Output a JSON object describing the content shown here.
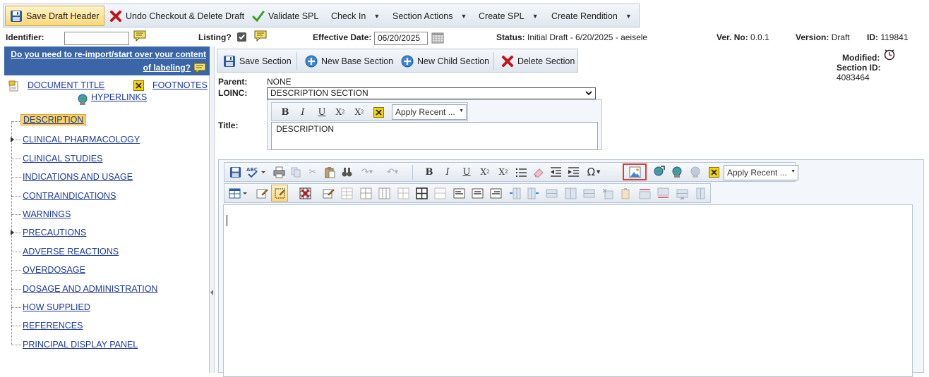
{
  "toolbar": {
    "save_draft_header": "Save Draft Header",
    "undo_checkout": "Undo Checkout & Delete Draft",
    "validate_spl": "Validate SPL",
    "check_in": "Check In",
    "section_actions": "Section Actions",
    "create_spl": "Create SPL",
    "create_rendition": "Create Rendition"
  },
  "info": {
    "identifier_label": "Identifier:",
    "identifier_value": "",
    "listing_label": "Listing?",
    "effective_date_label": "Effective Date:",
    "effective_date_value": "06/20/2025",
    "status_label": "Status:",
    "status_value": "Initial Draft - 6/20/2025 - aeisele",
    "ver_no_label": "Ver. No:",
    "ver_no_value": "0.0.1",
    "version_label": "Version:",
    "version_value": "Draft",
    "id_label": "ID:",
    "id_value": "119841"
  },
  "left": {
    "reimport_line1": "Do you need to re-import/start over your content",
    "reimport_line2": "of labeling?",
    "document_title": "DOCUMENT TITLE",
    "footnotes": "FOOTNOTES",
    "hyperlinks": "HYPERLINKS",
    "tree": [
      "DESCRIPTION",
      "CLINICAL PHARMACOLOGY",
      "CLINICAL STUDIES",
      "INDICATIONS AND USAGE",
      "CONTRAINDICATIONS",
      "WARNINGS",
      "PRECAUTIONS",
      "ADVERSE REACTIONS",
      "OVERDOSAGE",
      "DOSAGE AND ADMINISTRATION",
      "HOW SUPPLIED",
      "REFERENCES",
      "PRINCIPAL DISPLAY PANEL"
    ]
  },
  "section_toolbar": {
    "save_section": "Save Section",
    "new_base_section": "New Base Section",
    "new_child_section": "New Child Section",
    "delete_section": "Delete Section"
  },
  "section": {
    "parent_label": "Parent:",
    "parent_value": "NONE",
    "loinc_label": "LOINC:",
    "loinc_value": "DESCRIPTION SECTION",
    "title_label": "Title:",
    "title_value": "DESCRIPTION",
    "modified_label": "Modified:",
    "section_id_label": "Section ID:",
    "section_id_value": "4083464"
  },
  "editor": {
    "apply_recent": "Apply Recent ..."
  },
  "colors": {
    "accent_blue": "#3a66a8",
    "link_blue": "#1a3a9c",
    "selection_yellow": "#fcd35c",
    "highlight_red": "#e53935"
  }
}
